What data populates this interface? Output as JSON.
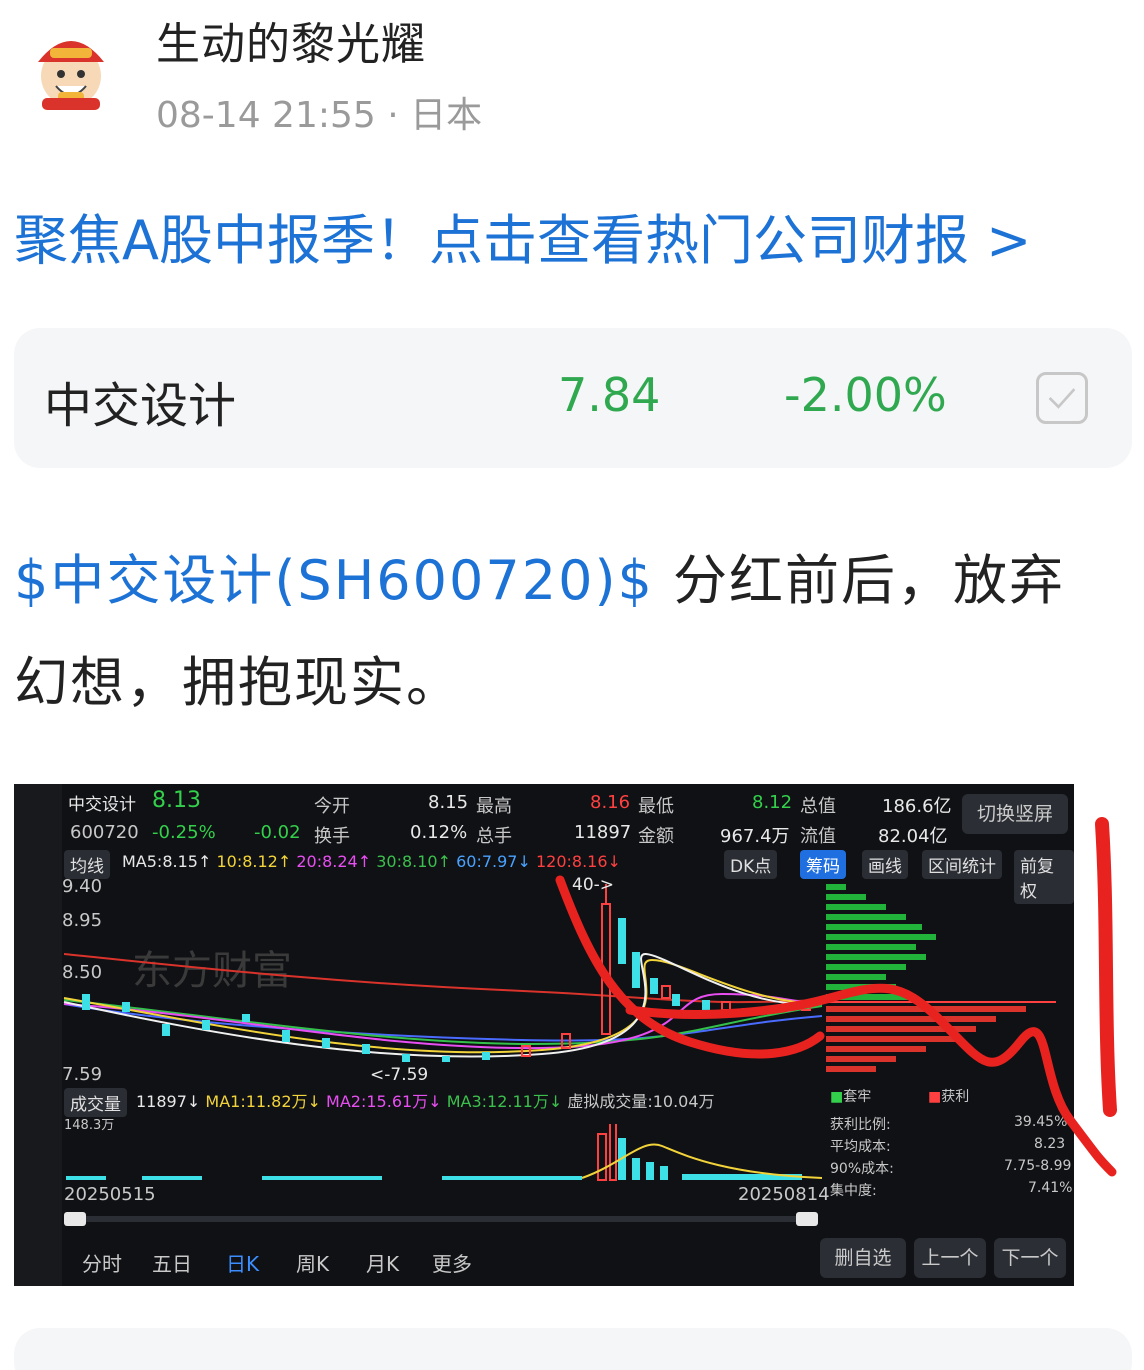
{
  "post": {
    "author": "生动的黎光耀",
    "time": "08-14 21:55",
    "separator": "·",
    "location": "日本",
    "promo_text": "聚焦A股中报季！点击查看热门公司财报 >",
    "cashtag": "$中交设计(SH600720)$",
    "body_line1": "分红前后，放弃",
    "body_line2": "幻想，拥抱现实。"
  },
  "stock_card": {
    "name": "中交设计",
    "price": "7.84",
    "change": "-2.00%",
    "check_icon": "checkbox-icon"
  },
  "chart_shot": {
    "name": "中交设计",
    "code": "600720",
    "price": "8.13",
    "change_pct": "-0.25%",
    "change": "-0.02",
    "open_label": "今开",
    "open": "8.15",
    "high_label": "最高",
    "high": "8.16",
    "low_label": "最低",
    "low": "8.12",
    "mcap_label": "总值",
    "mcap": "186.6亿",
    "turnover_label": "换手",
    "turnover": "0.12%",
    "volume_label": "总手",
    "volume": "11897",
    "amount_label": "金额",
    "amount": "967.4万",
    "float_label": "流值",
    "float_cap": "82.04亿",
    "switch_btn": "切换竖屏",
    "ma_label": "均线",
    "ma5": "MA5:8.15↑",
    "ma10": "10:8.12↑",
    "ma20": "20:8.24↑",
    "ma30": "30:8.10↑",
    "ma60": "60:7.97↓",
    "ma120": "120:8.16↓",
    "tool_dk": "DK点",
    "tool_chip": "筹码",
    "tool_draw": "画线",
    "tool_range": "区间统计",
    "tool_adjust": "前复权",
    "y_ticks": [
      "9.40",
      "8.95",
      "8.50",
      "7.59"
    ],
    "annotation_40": "40->",
    "annotation_low": "<-7.59",
    "watermark": "东方财富",
    "vol_label": "成交量",
    "vol_value": "11897↓",
    "vol_ma1": "MA1:11.82万↓",
    "vol_ma2": "MA2:15.61万↓",
    "vol_ma3": "MA3:12.11万↓",
    "vol_virtual": "虚拟成交量:10.04万",
    "vol_max": "148.3万",
    "date_start": "20250515",
    "date_end": "20250814",
    "chip_legend_trapped": "套牢",
    "chip_legend_profit": "获利",
    "chip_stats": [
      {
        "label": "获利比例:",
        "value": "39.45%"
      },
      {
        "label": "平均成本:",
        "value": "8.23"
      },
      {
        "label": "90%成本:",
        "value": "7.75-8.99"
      },
      {
        "label": "集中度:",
        "value": "7.41%"
      }
    ],
    "tabs": [
      "分时",
      "五日",
      "日K",
      "周K",
      "月K",
      "更多"
    ],
    "btn_delete": "删自选",
    "btn_prev": "上一个",
    "btn_next": "下一个",
    "colors": {
      "up": "#ff4040",
      "down": "#33d04b",
      "accent": "#1f6fe0",
      "marker": "#e8231f"
    }
  }
}
